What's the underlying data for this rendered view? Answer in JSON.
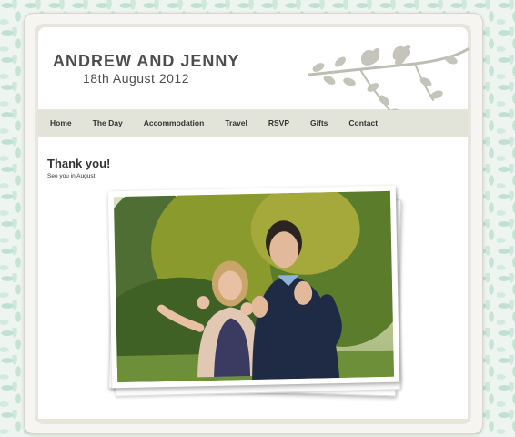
{
  "header": {
    "title": "ANDREW AND JENNY",
    "date": "18th August 2012"
  },
  "nav": {
    "items": [
      {
        "label": "Home"
      },
      {
        "label": "The Day"
      },
      {
        "label": "Accommodation"
      },
      {
        "label": "Travel"
      },
      {
        "label": "RSVP"
      },
      {
        "label": "Gifts"
      },
      {
        "label": "Contact"
      }
    ]
  },
  "main": {
    "heading": "Thank you!",
    "subtext": "See you in August!"
  },
  "colors": {
    "pattern": "#c6e3d6",
    "nav_bar": "#e3e4d9",
    "text": "#4d4d4d",
    "branch": "#bdbdb3"
  },
  "icons": {
    "decoration": "bird-branch-icon"
  }
}
